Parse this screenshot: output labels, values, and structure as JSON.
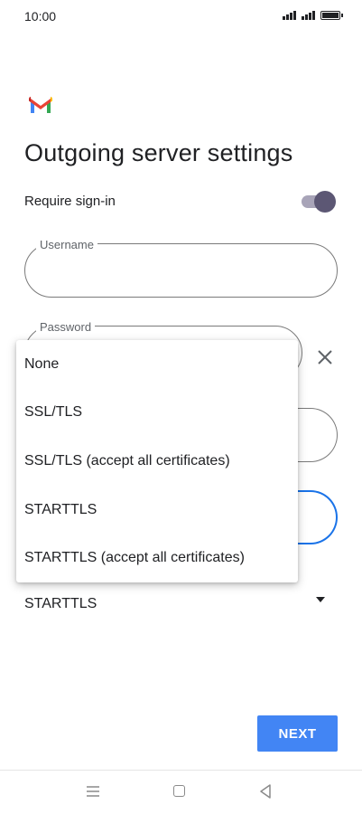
{
  "status_bar": {
    "time": "10:00"
  },
  "app": {
    "logo": "gmail-logo"
  },
  "page": {
    "title": "Outgoing server settings",
    "require_signin_label": "Require sign-in",
    "require_signin_enabled": true
  },
  "fields": {
    "username_label": "Username",
    "username_value": "",
    "password_label": "Password",
    "password_value": ""
  },
  "security": {
    "selected": "STARTTLS"
  },
  "dropdown": {
    "options": [
      "None",
      "SSL/TLS",
      "SSL/TLS (accept all certificates)",
      "STARTTLS",
      "STARTTLS (accept all certificates)"
    ]
  },
  "actions": {
    "next_label": "NEXT"
  },
  "icons": {
    "clear": "close-icon",
    "nav_menu": "menu-icon",
    "nav_home": "home-icon",
    "nav_back": "back-icon"
  },
  "colors": {
    "accent": "#4285f4",
    "focus": "#1a73e8",
    "toggle_thumb": "#5c5774"
  }
}
